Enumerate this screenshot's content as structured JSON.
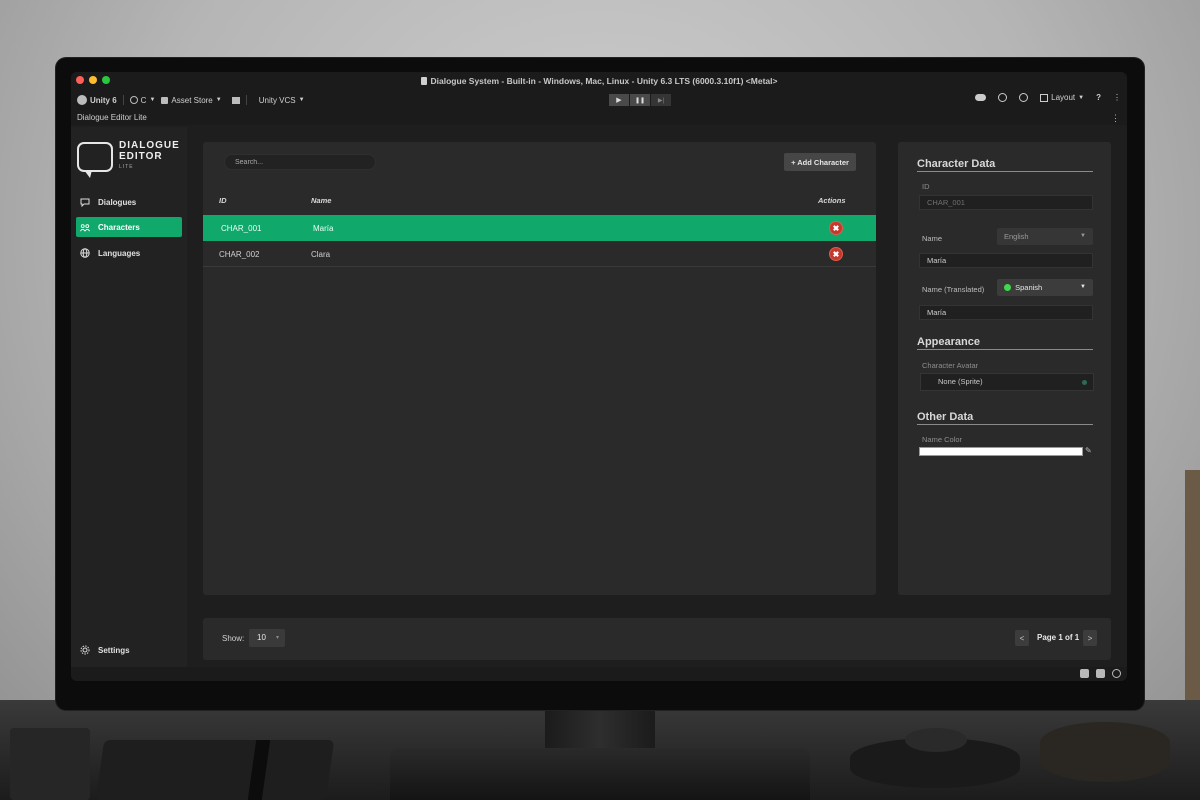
{
  "window": {
    "title": "Dialogue System - Built-in - Windows, Mac, Linux - Unity 6.3 LTS (6000.3.10f1) <Metal>"
  },
  "toolbar": {
    "unity_label": "Unity 6",
    "account_label": "C",
    "asset_store_label": "Asset Store",
    "vcs_label": "Unity VCS",
    "play_icon": "▶",
    "pause_icon": "❚❚",
    "step_icon": "▶|",
    "layout_label": "Layout",
    "help_icon": "?",
    "more_icon": "⋮"
  },
  "tab": {
    "name": "Dialogue Editor Lite",
    "menu_icon": "⋮"
  },
  "brand": {
    "line1": "DIALOGUE",
    "line2": "EDITOR",
    "line3": "LITE"
  },
  "sidebar": {
    "items": [
      {
        "label": "Dialogues",
        "icon": "chat-icon"
      },
      {
        "label": "Characters",
        "icon": "people-icon",
        "active": true
      },
      {
        "label": "Languages",
        "icon": "globe-icon"
      }
    ],
    "settings_label": "Settings"
  },
  "main": {
    "search_placeholder": "Search...",
    "add_button": "+ Add Character",
    "columns": {
      "id": "ID",
      "name": "Name",
      "actions": "Actions"
    },
    "rows": [
      {
        "id": "CHAR_001",
        "name": "María",
        "selected": true
      },
      {
        "id": "CHAR_002",
        "name": "Clara",
        "selected": false
      }
    ],
    "delete_icon": "✖"
  },
  "footer": {
    "show_label": "Show:",
    "show_value": "10",
    "prev": "<",
    "next": ">",
    "page_text": "Page 1 of 1"
  },
  "inspector": {
    "character_data_title": "Character Data",
    "id_label": "ID",
    "id_value": "CHAR_001",
    "name_label": "Name",
    "name_language": "English",
    "name_value": "María",
    "translated_label": "Name (Translated)",
    "translated_language": "Spanish",
    "translated_value": "María",
    "appearance_title": "Appearance",
    "avatar_label": "Character Avatar",
    "avatar_value": "None (Sprite)",
    "other_title": "Other Data",
    "name_color_label": "Name Color",
    "name_color": "#ffffff"
  },
  "colors": {
    "accent": "#10a86b",
    "danger": "#c23a2e"
  }
}
